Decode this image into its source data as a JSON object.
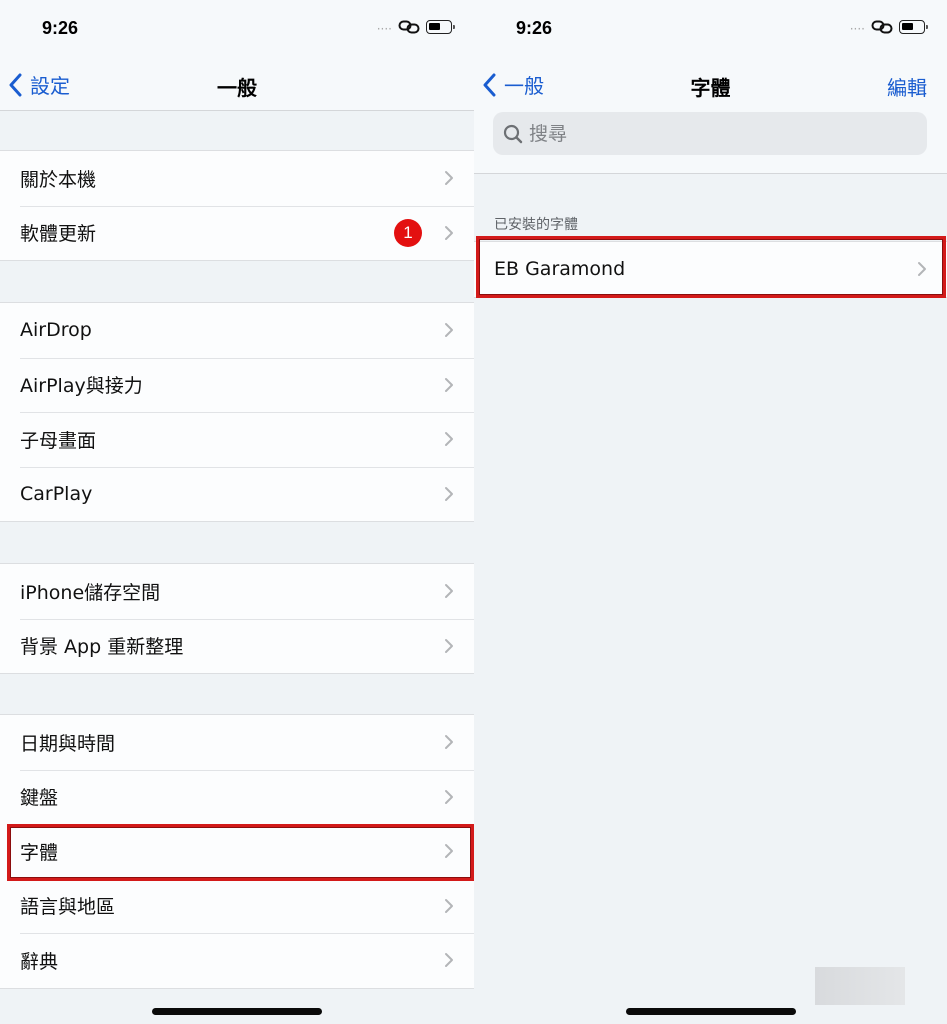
{
  "left_screen": {
    "status_bar": {
      "time": "9:26",
      "signal": "····",
      "link_icon": "link-icon",
      "battery_icon": "battery-icon"
    },
    "nav": {
      "back_label": "設定",
      "title": "一般"
    },
    "groups": [
      {
        "items": [
          {
            "label": "關於本機"
          },
          {
            "label": "軟體更新",
            "badge": "1"
          }
        ]
      },
      {
        "items": [
          {
            "label": "AirDrop"
          },
          {
            "label": "AirPlay與接力"
          },
          {
            "label": "子母畫面"
          },
          {
            "label": "CarPlay"
          }
        ]
      },
      {
        "items": [
          {
            "label": "iPhone儲存空間"
          },
          {
            "label": "背景 App 重新整理"
          }
        ]
      },
      {
        "items": [
          {
            "label": "日期與時間"
          },
          {
            "label": "鍵盤"
          },
          {
            "label": "字體",
            "highlighted": true
          },
          {
            "label": "語言與地區"
          },
          {
            "label": "辭典"
          }
        ]
      }
    ]
  },
  "right_screen": {
    "status_bar": {
      "time": "9:26",
      "signal": "····",
      "link_icon": "link-icon",
      "battery_icon": "battery-icon"
    },
    "nav": {
      "back_label": "一般",
      "title": "字體",
      "action_label": "編輯"
    },
    "search": {
      "placeholder": "搜尋",
      "value": ""
    },
    "section_header": "已安裝的字體",
    "fonts": [
      {
        "label": "EB Garamond",
        "highlighted": true
      }
    ]
  },
  "colors": {
    "accent": "#1a5dd0",
    "badge": "#e31010",
    "highlight_box": "#d31a1a",
    "background": "#eff3f6"
  }
}
